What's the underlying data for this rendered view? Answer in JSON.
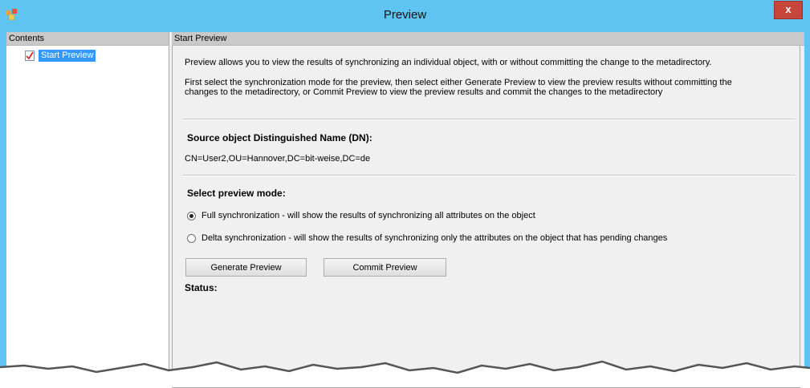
{
  "window": {
    "title": "Preview",
    "close_label": "x"
  },
  "left_pane": {
    "header": "Contents",
    "items": [
      {
        "label": "Start Preview"
      }
    ]
  },
  "right_pane": {
    "header": "Start Preview",
    "intro": "Preview allows you to view the results of synchronizing an individual object, with or without committing the change to the metadirectory.",
    "instructions_line1": "First select the synchronization  mode for the preview, then select either Generate Preview to view the preview results without committing the",
    "instructions_line2": "changes to the metadirectory, or Commit Preview to view the preview results and commit the changes to the metadirectory",
    "source_heading": "Source object Distinguished Name (DN):",
    "source_dn": "CN=User2,OU=Hannover,DC=bit-weise,DC=de",
    "mode_heading": "Select preview mode:",
    "modes": [
      {
        "label": "Full synchronization - will show the results of synchronizing all attributes on the object",
        "selected": true
      },
      {
        "label": "Delta synchronization - will show the results of synchronizing only the attributes on the object that has pending changes",
        "selected": false
      }
    ],
    "generate_label": "Generate Preview",
    "commit_label": "Commit Preview",
    "status_label": "Status:"
  },
  "colors": {
    "title_bar": "#5fc4f1",
    "close": "#c7463b",
    "selection": "#3399ff"
  },
  "icons": {
    "app": "app-icon",
    "tree_item": "checklist-icon"
  }
}
